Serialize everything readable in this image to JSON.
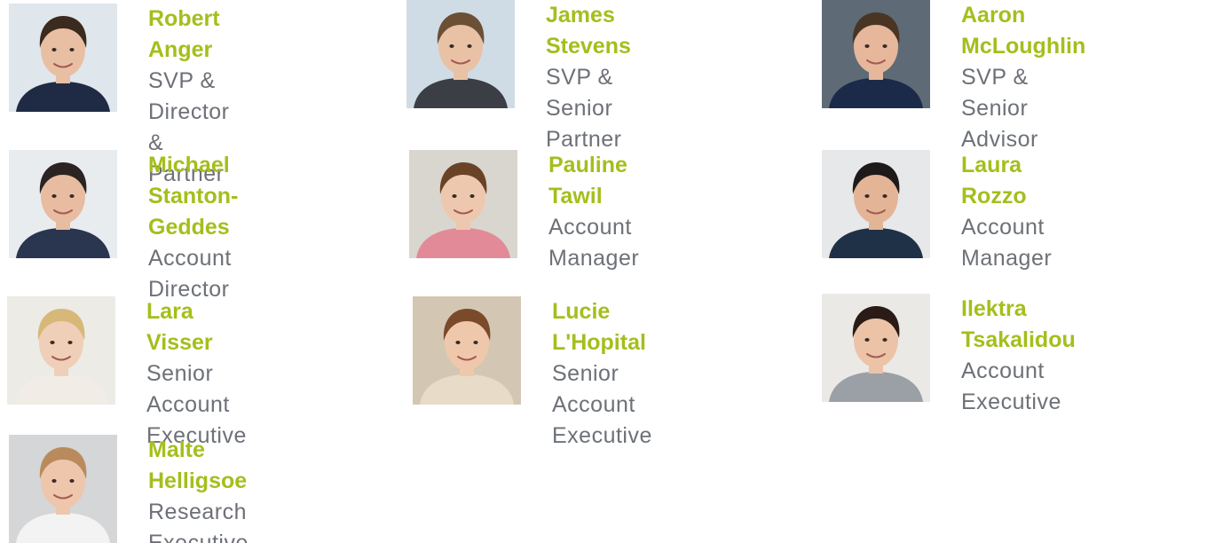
{
  "team": [
    {
      "name": "Robert Anger",
      "title": "SVP & Director\n& Partner",
      "bg": "#dfe6ec",
      "hair": "#3b2a1e",
      "shirt": "#1f2b44",
      "skin": "#e8bfa3"
    },
    {
      "name": "James Stevens",
      "title": "SVP & Senior Partner",
      "bg": "#cfdce6",
      "hair": "#6b5036",
      "shirt": "#3b3f45",
      "skin": "#e9c2a6"
    },
    {
      "name": "Aaron McLoughlin",
      "title": "SVP & Senior Advisor",
      "bg": "#5e6b76",
      "hair": "#4a3525",
      "shirt": "#1c2a4a",
      "skin": "#e6b79b"
    },
    {
      "name": "Michael\nStanton-Geddes",
      "title": "Account Director",
      "bg": "#e8ecef",
      "hair": "#2b2422",
      "shirt": "#2a3550",
      "skin": "#e7bca0"
    },
    {
      "name": "Pauline Tawil",
      "title": "Account Manager",
      "bg": "#d9d6cf",
      "hair": "#6a4326",
      "shirt": "#e28a98",
      "skin": "#eec8ae"
    },
    {
      "name": "Laura Rozzo",
      "title": "Account Manager",
      "bg": "#e6e8ea",
      "hair": "#1e1a19",
      "shirt": "#1f3146",
      "skin": "#e3b596"
    },
    {
      "name": "Lara Visser",
      "title": "Senior Account\nExecutive",
      "bg": "#ecebe6",
      "hair": "#d7b879",
      "shirt": "#f1ede6",
      "skin": "#f0cfb8"
    },
    {
      "name": "Lucie L'Hopital",
      "title": "Senior Account\nExecutive",
      "bg": "#d3c7b4",
      "hair": "#7a4a2a",
      "shirt": "#e8dcc8",
      "skin": "#efc8ab"
    },
    {
      "name": "Ilektra Tsakalidou",
      "title": "Account Executive",
      "bg": "#ebe9e6",
      "hair": "#2a1b16",
      "shirt": "#9aa0a6",
      "skin": "#ecc3a7"
    },
    {
      "name": "Malte Helligsoe",
      "title": "Research Executive",
      "bg": "#d4d6d8",
      "hair": "#b98b5c",
      "shirt": "#f3f3f3",
      "skin": "#eec6ac"
    }
  ]
}
